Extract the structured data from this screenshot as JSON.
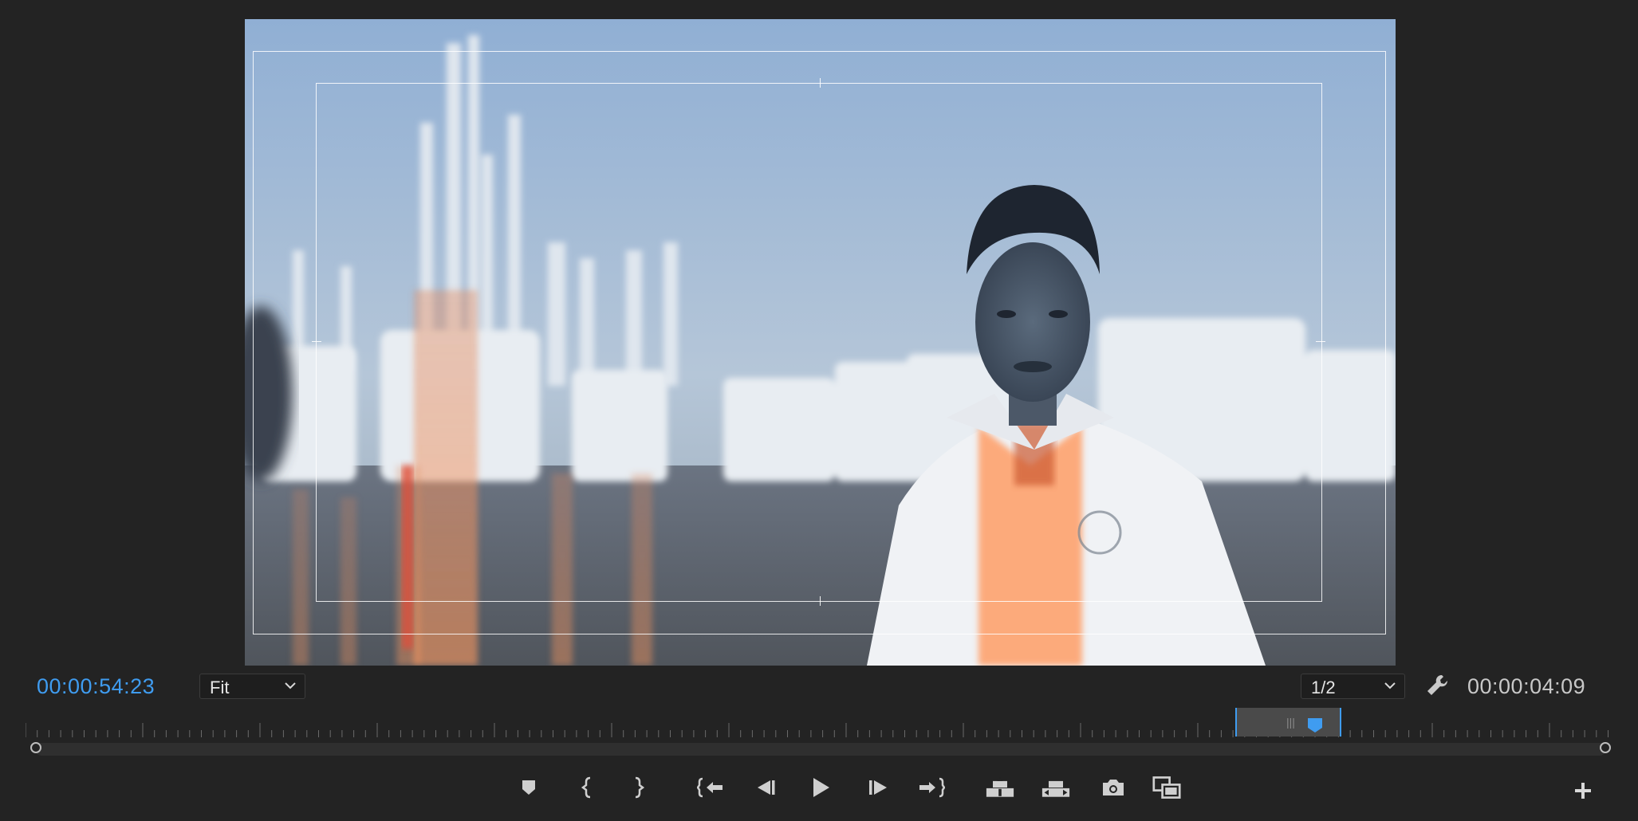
{
  "monitor": {
    "current_timecode": "00:00:54:23",
    "duration_timecode": "00:00:04:09",
    "zoom_level": "Fit",
    "playback_resolution": "1/2",
    "safe_margins_visible": true
  },
  "icons": {
    "settings": "wrench-icon",
    "add": "plus-icon"
  },
  "transport_controls": [
    {
      "name": "add-marker",
      "icon": "marker-icon"
    },
    {
      "name": "mark-in",
      "icon": "mark-in-icon"
    },
    {
      "name": "mark-out",
      "icon": "mark-out-icon"
    },
    {
      "name": "go-to-in",
      "icon": "go-to-in-icon"
    },
    {
      "name": "step-back",
      "icon": "step-back-icon"
    },
    {
      "name": "play",
      "icon": "play-icon"
    },
    {
      "name": "step-forward",
      "icon": "step-forward-icon"
    },
    {
      "name": "go-to-out",
      "icon": "go-to-out-icon"
    },
    {
      "name": "lift",
      "icon": "lift-icon"
    },
    {
      "name": "extract",
      "icon": "extract-icon"
    },
    {
      "name": "export-frame",
      "icon": "camera-icon"
    },
    {
      "name": "comparison-view",
      "icon": "comparison-view-icon"
    }
  ],
  "colors": {
    "accent": "#3f9cf0",
    "panel_background": "#232323",
    "text_secondary": "#c8c8c8"
  }
}
